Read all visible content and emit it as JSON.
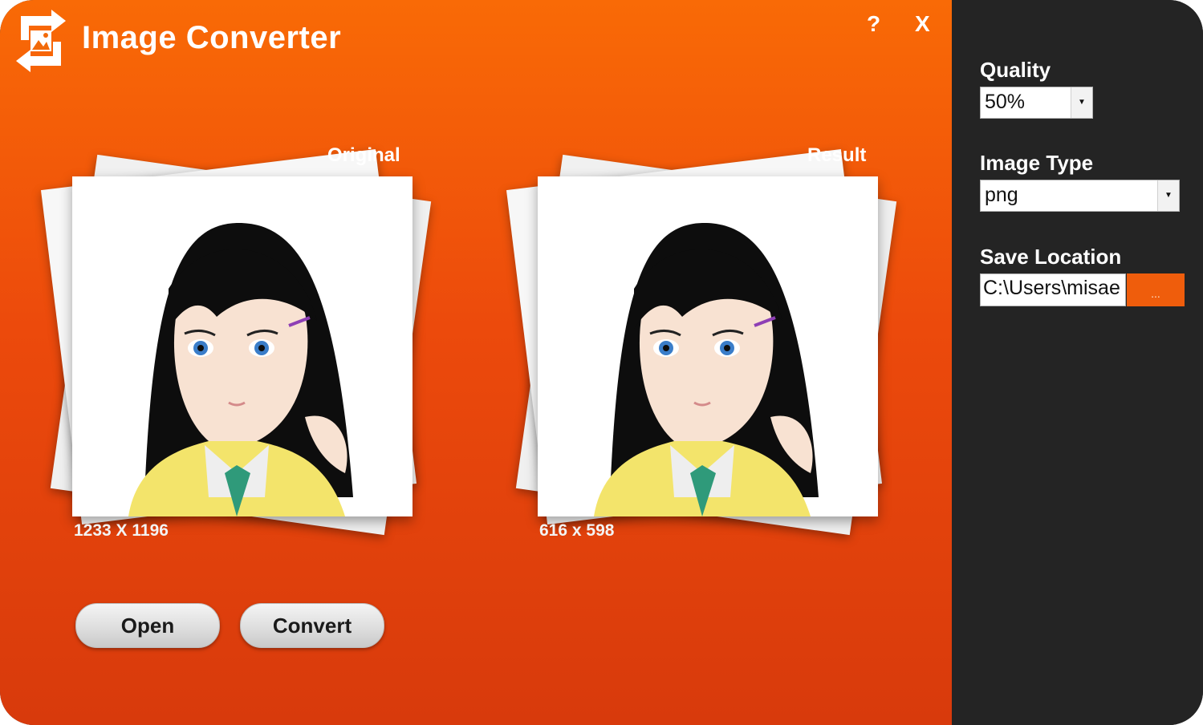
{
  "app": {
    "title": "Image Converter",
    "help_label": "?",
    "close_label": "X"
  },
  "original": {
    "label": "Original",
    "dimensions": "1233 X 1196"
  },
  "result": {
    "label": "Result",
    "dimensions": "616 x 598"
  },
  "buttons": {
    "open_label": "Open",
    "convert_label": "Convert"
  },
  "settings": {
    "quality_label": "Quality",
    "quality_value": "50%",
    "image_type_label": "Image Type",
    "image_type_value": "png",
    "save_location_label": "Save Location",
    "save_location_value": "C:\\Users\\misae",
    "browse_label": "..."
  },
  "colors": {
    "accent": "#f2610a",
    "sidebar": "#242424",
    "button": "#dcdcdc"
  },
  "icons": [
    "convert-arrows-icon",
    "chevron-down-icon"
  ]
}
